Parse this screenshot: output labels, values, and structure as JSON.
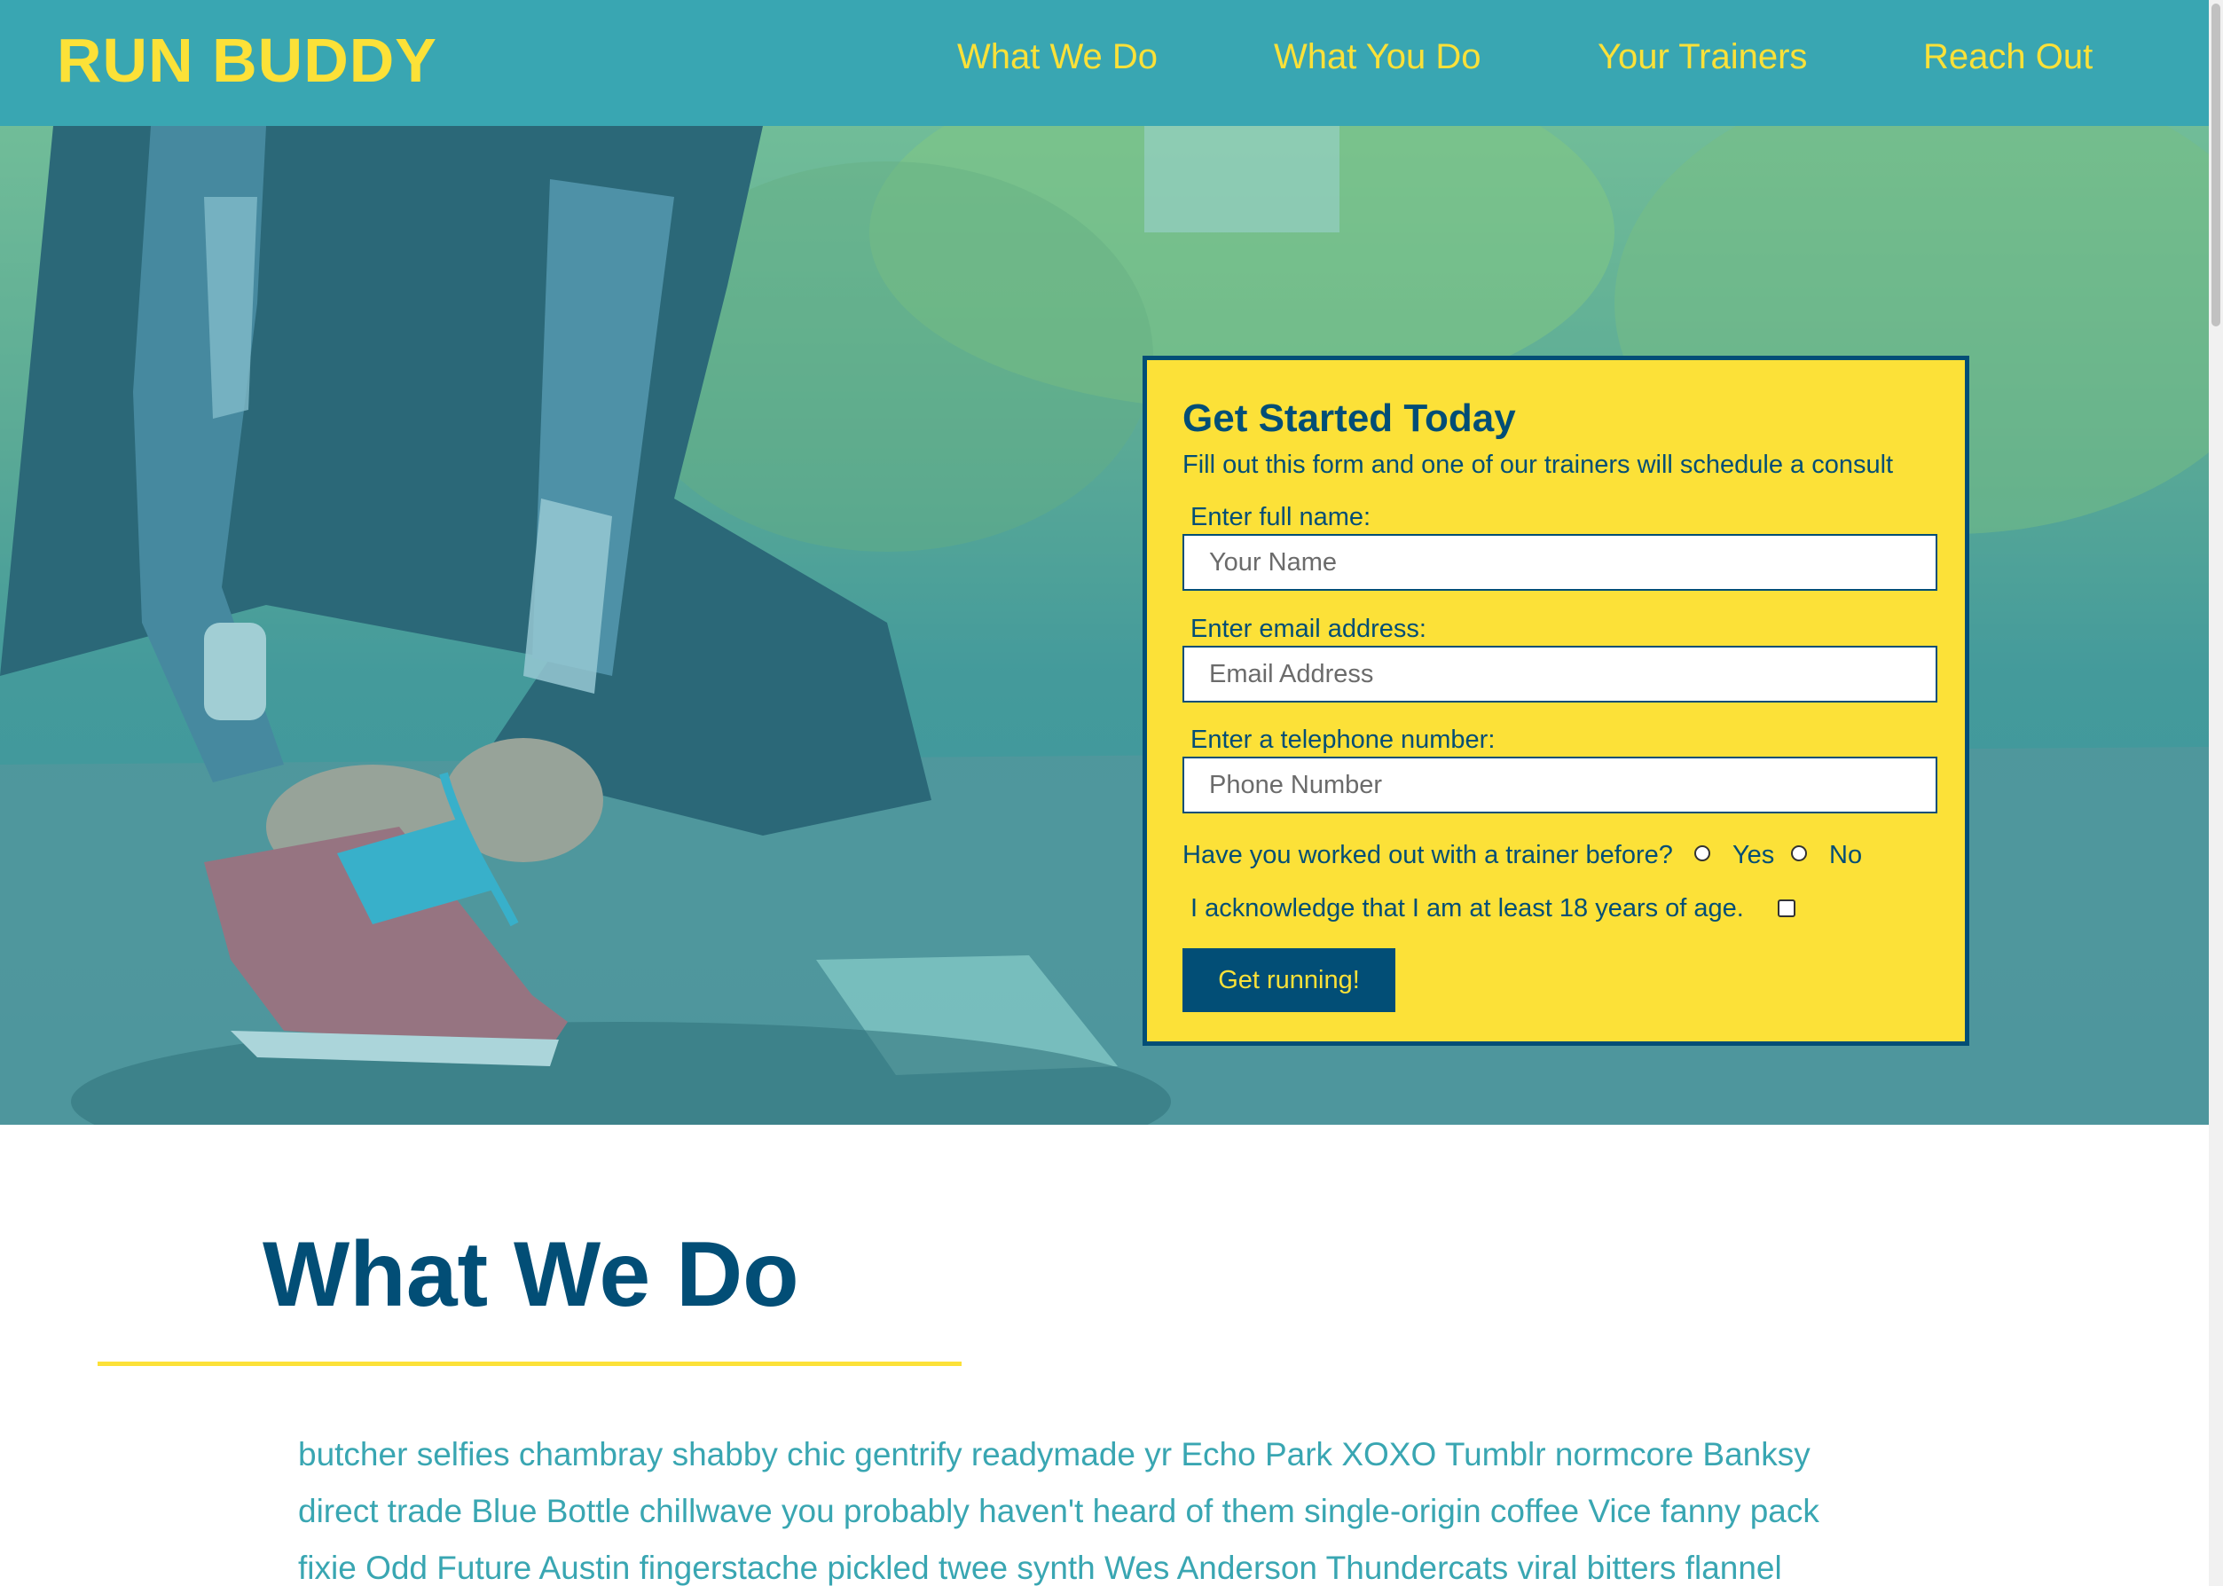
{
  "header": {
    "logo": "RUN BUDDY",
    "nav": [
      {
        "label": "What We Do"
      },
      {
        "label": "What You Do"
      },
      {
        "label": "Your Trainers"
      },
      {
        "label": "Reach Out"
      }
    ]
  },
  "form": {
    "title": "Get Started Today",
    "subtitle": "Fill out this form and one of our trainers will schedule a consult",
    "name_label": "Enter full name:",
    "name_placeholder": "Your Name",
    "email_label": "Enter email address:",
    "email_placeholder": "Email Address",
    "phone_label": "Enter a telephone number:",
    "phone_placeholder": "Phone Number",
    "trainer_question": "Have you worked out with a trainer before?",
    "option_yes": "Yes",
    "option_no": "No",
    "acknowledge": "I acknowledge that I am at least 18 years of age.",
    "submit_label": "Get running!"
  },
  "section": {
    "title": "What We Do",
    "body": "butcher selfies chambray shabby chic gentrify readymade yr Echo Park XOXO Tumblr normcore Banksy direct trade Blue Bottle chillwave you probably haven't heard of them single-origin coffee Vice fanny pack fixie Odd Future Austin fingerstache pickled twee synth Wes Anderson Thundercats viral bitters flannel"
  },
  "colors": {
    "primary": "#39a6b2",
    "accent": "#fce138",
    "dark": "#024e76"
  }
}
